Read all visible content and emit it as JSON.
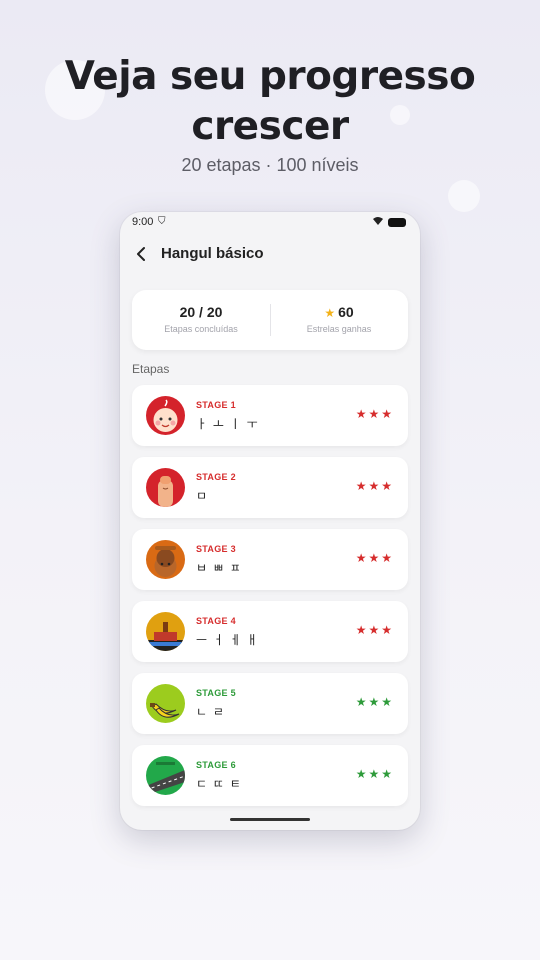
{
  "promo": {
    "headline_line1": "Veja seu progresso",
    "headline_line2": "crescer",
    "subtitle": "20 etapas · 100 níveis"
  },
  "status_bar": {
    "time": "9:00"
  },
  "app_bar": {
    "back_icon": "chevron-left-icon",
    "title": "Hangul básico"
  },
  "summary": {
    "completed_value": "20 / 20",
    "completed_label": "Etapas concluídas",
    "stars_value": "60",
    "stars_label": "Estrelas ganhas"
  },
  "section_title": "Etapas",
  "stages": [
    {
      "label": "STAGE 1",
      "chars": "ㅏ ㅗ ㅣ ㅜ",
      "stars": "★★★",
      "stars_earned": 3,
      "accent": "#d62d2d"
    },
    {
      "label": "STAGE 2",
      "chars": "ㅁ",
      "stars": "★★★",
      "stars_earned": 3,
      "accent": "#d62d2d"
    },
    {
      "label": "STAGE 3",
      "chars": "ㅂ ㅃ ㅍ",
      "stars": "★★★",
      "stars_earned": 3,
      "accent": "#d62d2d"
    },
    {
      "label": "STAGE 4",
      "chars": "ㅡ ㅓ ㅔ ㅐ",
      "stars": "★★★",
      "stars_earned": 3,
      "accent": "#d62d2d"
    },
    {
      "label": "STAGE 5",
      "chars": "ㄴ ㄹ",
      "stars": "★★★",
      "stars_earned": 3,
      "accent": "#2e9b3a"
    },
    {
      "label": "STAGE 6",
      "chars": "ㄷ ㄸ ㅌ",
      "stars": "★★★",
      "stars_earned": 3,
      "accent": "#2e9b3a"
    }
  ]
}
